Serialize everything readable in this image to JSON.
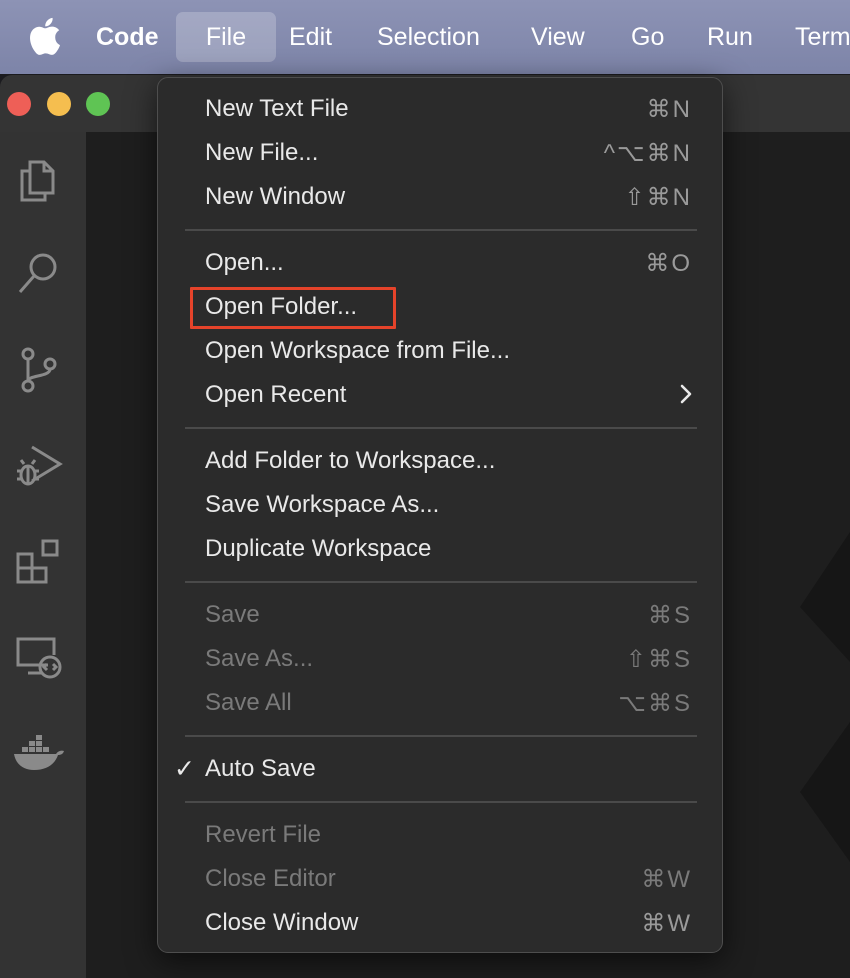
{
  "menubar": {
    "items": [
      "Code",
      "File",
      "Edit",
      "Selection",
      "View",
      "Go",
      "Run",
      "Term"
    ]
  },
  "file_menu": {
    "groups": [
      [
        {
          "label": "New Text File",
          "shortcut": "⌘N",
          "enabled": true
        },
        {
          "label": "New File...",
          "shortcut": "^⌥⌘N",
          "enabled": true
        },
        {
          "label": "New Window",
          "shortcut": "⇧⌘N",
          "enabled": true
        }
      ],
      [
        {
          "label": "Open...",
          "shortcut": "⌘O",
          "enabled": true
        },
        {
          "label": "Open Folder...",
          "shortcut": "",
          "enabled": true,
          "highlighted": true
        },
        {
          "label": "Open Workspace from File...",
          "shortcut": "",
          "enabled": true
        },
        {
          "label": "Open Recent",
          "shortcut": "",
          "enabled": true,
          "submenu": true
        }
      ],
      [
        {
          "label": "Add Folder to Workspace...",
          "shortcut": "",
          "enabled": true
        },
        {
          "label": "Save Workspace As...",
          "shortcut": "",
          "enabled": true
        },
        {
          "label": "Duplicate Workspace",
          "shortcut": "",
          "enabled": true
        }
      ],
      [
        {
          "label": "Save",
          "shortcut": "⌘S",
          "enabled": false
        },
        {
          "label": "Save As...",
          "shortcut": "⇧⌘S",
          "enabled": false
        },
        {
          "label": "Save All",
          "shortcut": "⌥⌘S",
          "enabled": false
        }
      ],
      [
        {
          "label": "Auto Save",
          "shortcut": "",
          "enabled": true,
          "checked": true
        }
      ],
      [
        {
          "label": "Revert File",
          "shortcut": "",
          "enabled": false
        },
        {
          "label": "Close Editor",
          "shortcut": "⌘W",
          "enabled": false
        },
        {
          "label": "Close Window",
          "shortcut": "⌘W",
          "enabled": true
        }
      ]
    ]
  },
  "activity_bar": [
    "explorer-icon",
    "search-icon",
    "source-control-icon",
    "run-debug-icon",
    "extensions-icon",
    "remote-explorer-icon",
    "docker-icon"
  ],
  "colors": {
    "menubar_bg": "#8a90b2",
    "menu_bg": "#2b2b2b",
    "highlight_border": "#e5432a",
    "traffic_red": "#ee5f57",
    "traffic_yellow": "#f5be4f",
    "traffic_green": "#5fc454"
  }
}
